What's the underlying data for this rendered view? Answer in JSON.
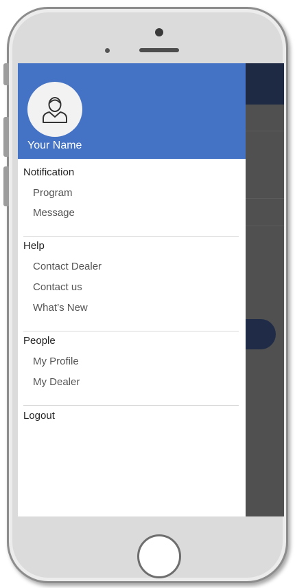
{
  "user": {
    "name": "Your Name"
  },
  "sections": [
    {
      "title": "Notification",
      "items": [
        "Program",
        "Message"
      ]
    },
    {
      "title": "Help",
      "items": [
        "Contact Dealer",
        "Contact us",
        "What’s New"
      ]
    },
    {
      "title": "People",
      "items": [
        "My Profile",
        "My Dealer"
      ]
    }
  ],
  "logout_label": "Logout",
  "colors": {
    "drawer_header": "#4472c4",
    "app_header": "#1e2a44",
    "overlay": "#505050"
  }
}
